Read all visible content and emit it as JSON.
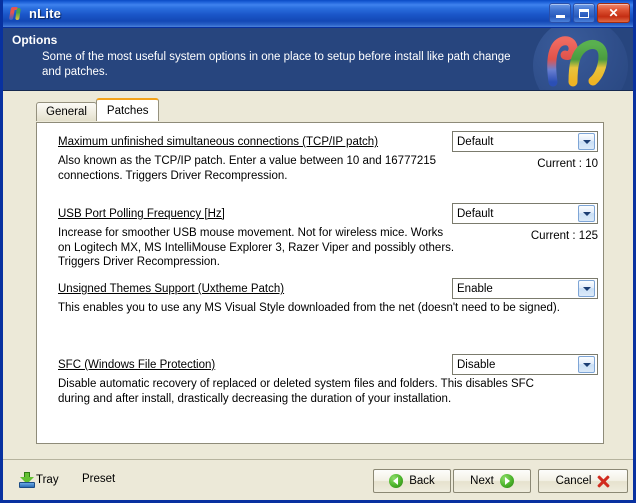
{
  "window": {
    "title": "nLite",
    "app_icon": "nlite-logo-icon",
    "buttons": {
      "minimize": "minimize-icon",
      "maximize": "maximize-icon",
      "close": "✕"
    }
  },
  "banner": {
    "title": "Options",
    "subtitle": "Some of the most useful system options in one place to setup before install like path change and patches.",
    "logo": "nlite-logo-icon"
  },
  "tabs": [
    {
      "label": "General",
      "active": false
    },
    {
      "label": "Patches",
      "active": true
    }
  ],
  "options": [
    {
      "title": "Maximum unfinished simultaneous connections (TCP/IP patch)",
      "description": "Also known as the TCP/IP patch. Enter a value between 10 and 16777215 connections. Triggers Driver Recompression.",
      "value": "Default",
      "current": "Current : 10"
    },
    {
      "title": "USB Port Polling Frequency [Hz]",
      "description": "Increase for smoother USB mouse movement. Not for wireless mice. Works on Logitech MX, MS IntelliMouse Explorer 3, Razer Viper and possibly others. Triggers Driver Recompression.",
      "value": "Default",
      "current": "Current : 125"
    },
    {
      "title": "Unsigned Themes Support (Uxtheme Patch)",
      "description": "This enables you to use any MS Visual Style downloaded from the net (doesn't need to be signed).",
      "value": "Enable",
      "current": ""
    },
    {
      "title": "SFC (Windows File Protection)",
      "description": "Disable automatic recovery of replaced or deleted system files and folders. This disables SFC during and after install, drastically decreasing the duration of your installation.",
      "value": "Disable",
      "current": ""
    }
  ],
  "footer": {
    "tray_label": "Tray",
    "preset_label": "Preset",
    "back_label": "Back",
    "next_label": "Next",
    "cancel_label": "Cancel"
  },
  "colors": {
    "titlebar_blue": "#1a55c8",
    "banner_blue": "#27457e",
    "dialog_beige": "#ece9d8",
    "active_tab_accent": "#f3a21a",
    "panel_white": "#ffffff"
  }
}
